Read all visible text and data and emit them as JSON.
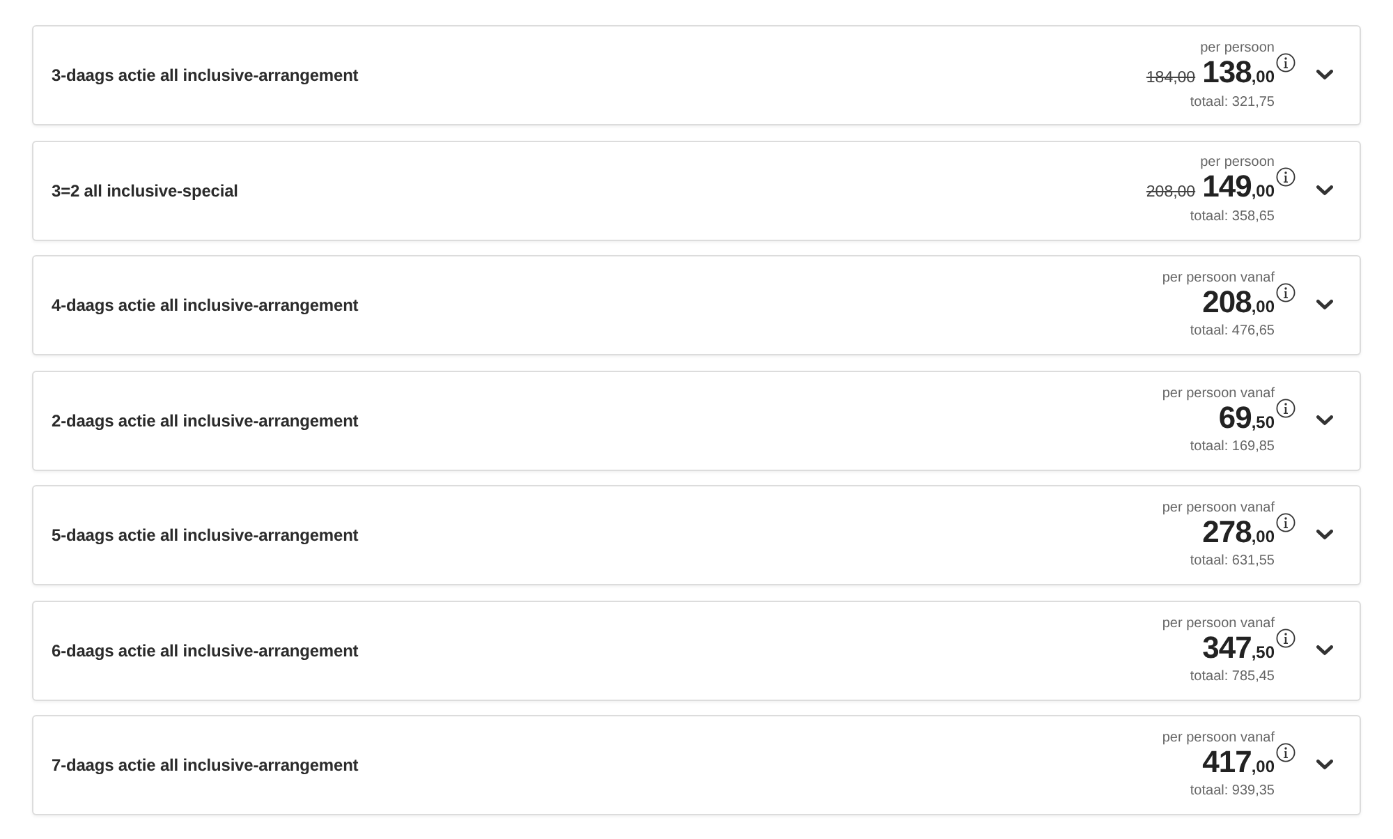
{
  "packages": [
    {
      "title": "3-daags actie all inclusive-arrangement",
      "price_label": "per persoon",
      "old_price": "184,00",
      "price_whole": "138",
      "price_decimals": ",00",
      "total": "totaal: 321,75",
      "expanded": false
    },
    {
      "title": "3=2 all inclusive-special",
      "price_label": "per persoon",
      "old_price": "208,00",
      "price_whole": "149",
      "price_decimals": ",00",
      "total": "totaal: 358,65",
      "expanded": false
    },
    {
      "title": "4-daags actie all inclusive-arrangement",
      "price_label": "per persoon vanaf",
      "price_whole": "208",
      "price_decimals": ",00",
      "total": "totaal: 476,65",
      "expanded": false
    },
    {
      "title": "2-daags actie all inclusive-arrangement",
      "price_label": "per persoon vanaf",
      "price_whole": "69",
      "price_decimals": ",50",
      "total": "totaal: 169,85",
      "expanded": false
    },
    {
      "title": "5-daags actie all inclusive-arrangement",
      "price_label": "per persoon vanaf",
      "price_whole": "278",
      "price_decimals": ",00",
      "total": "totaal: 631,55",
      "expanded": false
    },
    {
      "title": "6-daags actie all inclusive-arrangement",
      "price_label": "per persoon vanaf",
      "price_whole": "347",
      "price_decimals": ",50",
      "total": "totaal: 785,45",
      "expanded": false
    },
    {
      "title": "7-daags actie all inclusive-arrangement",
      "price_label": "per persoon vanaf",
      "price_whole": "417",
      "price_decimals": ",00",
      "total": "totaal: 939,35",
      "expanded": false
    }
  ]
}
